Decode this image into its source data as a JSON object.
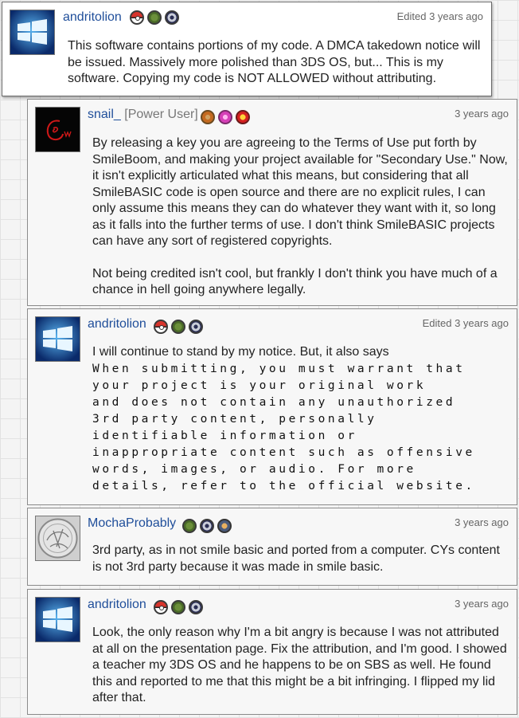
{
  "comments": [
    {
      "username": "andritolion",
      "role": "",
      "timestamp": "Edited 3 years ago",
      "badges": [
        "pokeball-badge-icon",
        "green-badge-icon",
        "target-badge-icon"
      ],
      "avatar": "windows-logo-avatar",
      "paragraphs": [
        "This software contains portions of my code. A DMCA takedown notice will be issued. Massively more polished than 3DS OS, but... This is my software. Copying my code is NOT ALLOWED without attributing."
      ]
    },
    {
      "username": "snail_",
      "role": "[Power User]",
      "timestamp": "3 years ago",
      "badges": [
        "orange-badge-icon",
        "pink-badge-icon",
        "heart-badge-icon"
      ],
      "avatar": "red-scribble-avatar",
      "paragraphs": [
        "By releasing a key you are agreeing to the Terms of Use put forth by SmileBoom, and making your project available for \"Secondary Use.\" Now, it isn't explicitly articulated what this means, but considering that all SmileBASIC code is open source and there are no explicit rules, I can only assume this means they can do whatever they want with it, so long as it falls into the further terms of use. I don't think SmileBASIC projects can have any sort of registered copyrights.",
        "Not being credited isn't cool, but frankly I don't think you have much of a chance in hell going anywhere legally."
      ]
    },
    {
      "username": "andritolion",
      "role": "",
      "timestamp": "Edited 3 years ago",
      "badges": [
        "pokeball-badge-icon",
        "green-badge-icon",
        "target-badge-icon"
      ],
      "avatar": "windows-logo-avatar",
      "paragraphs": [
        "I will continue to stand by my notice. But, it also says"
      ],
      "quote_lines": [
        "When submitting, you must warrant that",
        "your project is your original work",
        "and does not contain any unauthorized",
        "3rd party content, personally",
        "identifiable information or",
        "inappropriate content such as offensive",
        "words, images, or audio. For more",
        "details, refer to the official website."
      ]
    },
    {
      "username": "MochaProbably",
      "role": "",
      "timestamp": "3 years ago",
      "badges": [
        "green-badge-icon",
        "target-badge-icon",
        "person-badge-icon"
      ],
      "avatar": "gray-sketch-avatar",
      "paragraphs": [
        "3rd party, as in not smile basic and ported from a computer. CYs content is not 3rd party because it was made in smile basic."
      ]
    },
    {
      "username": "andritolion",
      "role": "",
      "timestamp": "3 years ago",
      "badges": [
        "pokeball-badge-icon",
        "green-badge-icon",
        "target-badge-icon"
      ],
      "avatar": "windows-logo-avatar",
      "paragraphs": [
        "Look, the only reason why I'm a bit angry is because I was not attributed at all on the presentation page. Fix the attribution, and I'm good. I showed a teacher my 3DS OS and he happens to be on SBS as well. He found this and reported to me that this might be a bit infringing. I flipped my lid after that."
      ]
    }
  ],
  "colors": {
    "username": "#1f4e9a",
    "timestamp": "#666666",
    "page_grid": "#e2e2e2"
  }
}
